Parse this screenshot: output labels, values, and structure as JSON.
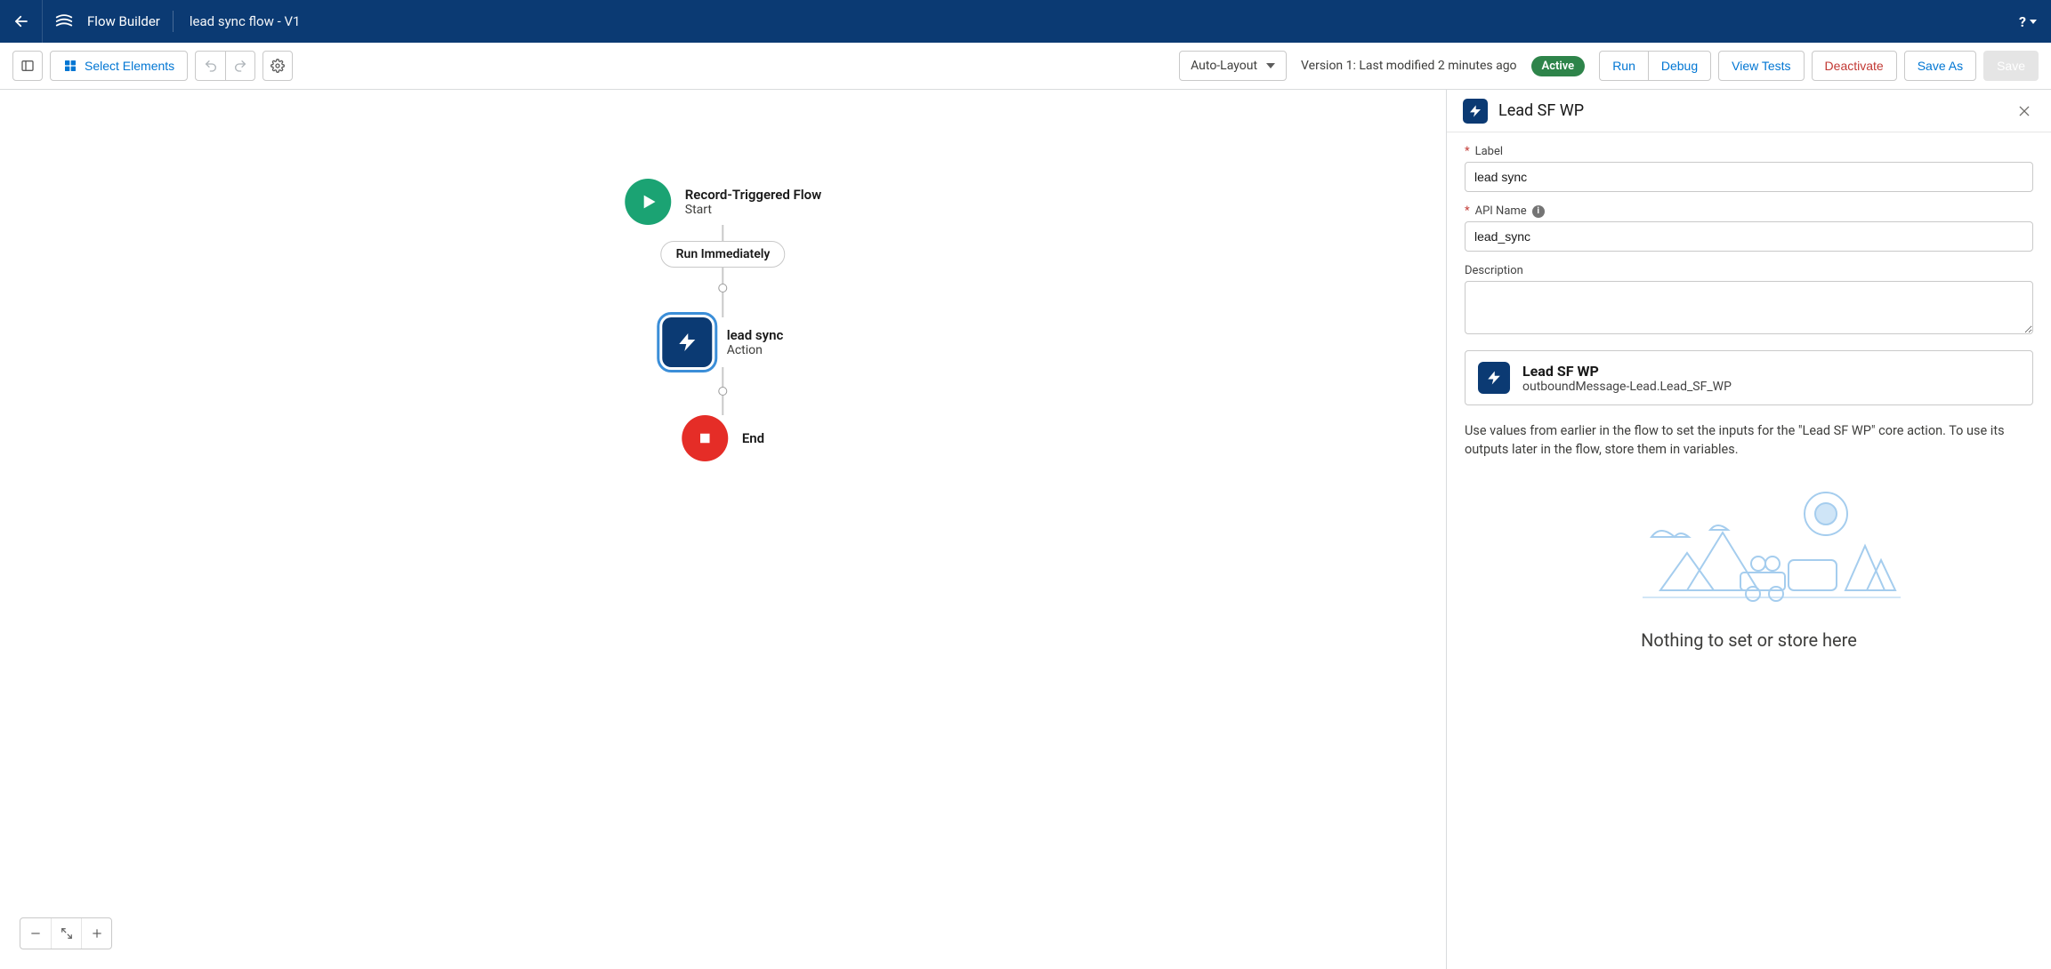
{
  "header": {
    "app_title": "Flow Builder",
    "flow_name": "lead sync flow - V1"
  },
  "toolbar": {
    "select_elements": "Select Elements",
    "layout_mode": "Auto-Layout",
    "version_status": "Version 1: Last modified 2 minutes ago",
    "active_pill": "Active",
    "run": "Run",
    "debug": "Debug",
    "view_tests": "View Tests",
    "deactivate": "Deactivate",
    "save_as": "Save As",
    "save": "Save"
  },
  "flow_nodes": {
    "start": {
      "title": "Record-Triggered Flow",
      "subtitle": "Start"
    },
    "run_immediately": "Run Immediately",
    "action": {
      "title": "lead sync",
      "subtitle": "Action"
    },
    "end": {
      "title": "End"
    }
  },
  "panel": {
    "title": "Lead SF WP",
    "label_label": "Label",
    "label_value": "lead sync",
    "api_name_label": "API Name",
    "api_name_value": "lead_sync",
    "description_label": "Description",
    "description_value": "",
    "action_card": {
      "title": "Lead SF WP",
      "subtitle": "outboundMessage-Lead.Lead_SF_WP"
    },
    "help_text": "Use values from earlier in the flow to set the inputs for the \"Lead SF WP\" core action. To use its outputs later in the flow, store them in variables.",
    "nothing": "Nothing to set or store here"
  }
}
